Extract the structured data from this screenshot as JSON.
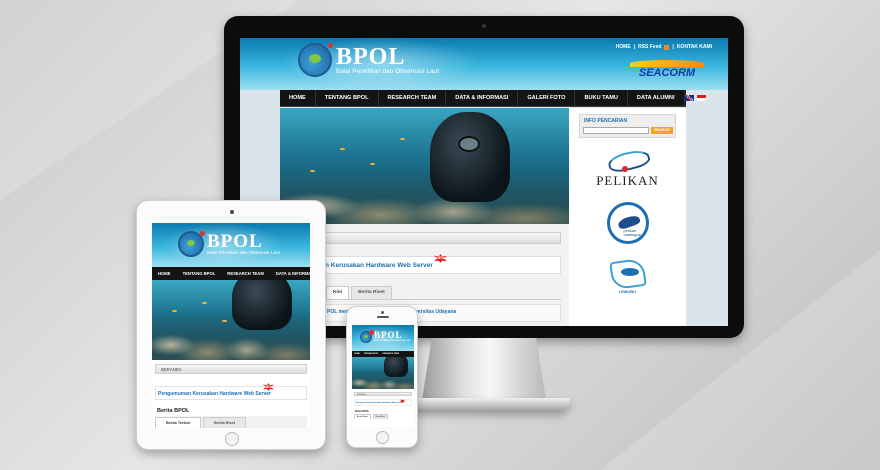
{
  "site": {
    "logo_title": "BPOL",
    "logo_subtitle": "Balai Penelitian dan Observasi Laut",
    "nav_items": [
      "HOME",
      "TENTANG BPOL",
      "RESEARCH TEAM",
      "DATA & INFORMASI",
      "GALERI FOTO",
      "BUKU TAMU",
      "DATA ALUMNI"
    ],
    "tablet_nav_items": [
      "HOME",
      "TENTANG BPOL",
      "RESEARCH TEAM",
      "DATA & INFORMASI"
    ],
    "phone_nav_items": [
      "HOME",
      "TENTANG BPOL",
      "RESEARCH TEAM"
    ],
    "colors": {
      "header_top": "#0a7bb0",
      "header_bottom": "#9fdff2",
      "nav_bg": "#141414",
      "link_blue": "#1f6fb0",
      "search_button": "#f0a51c",
      "new_badge": "#e0221c"
    }
  },
  "desktop": {
    "toplinks": {
      "home": "HOME",
      "sep1": "|",
      "rss": "RSS Feed",
      "sep2": "|",
      "contact": "KONTAK KAMI"
    },
    "partner_logo": {
      "title": "SEACORM"
    },
    "news_headline": "n Kerusakan Hardware Web Server",
    "new_badge": "NEW",
    "tabs": [
      {
        "label": "Kini"
      },
      {
        "label": "Berita Riset"
      }
    ],
    "article_headline": "POL mengisi Kuliah Tamu di FKP Universitas Udayana",
    "search": {
      "label": "INFO PENCARIAN",
      "placeholder": "",
      "button": "SEARCH"
    },
    "sidebar_partners": {
      "pelikan": "PELIKAN",
      "catalogue": "pelikan catalogue",
      "lemuru": "LEMURU"
    }
  },
  "tablet": {
    "breadcrumb": "BERANDA",
    "news_headline": "Pengumuman Kerusakan Hardware Web Server",
    "new_badge": "NEW",
    "section_title": "Berita BPOL",
    "tabs": [
      {
        "label": "Berita Terkini"
      },
      {
        "label": "Berita Riset"
      }
    ]
  },
  "phone": {
    "breadcrumb": "BERANDA",
    "news_headline": "Pengumuman Kerusakan Hardware Web Server",
    "new_badge": "NEW",
    "section_title": "Berita BPOL",
    "tabs": [
      {
        "label": "Berita Terkini"
      },
      {
        "label": "Berita Riset"
      }
    ]
  },
  "icons": {
    "flag_english": "uk-flag-icon",
    "flag_indonesia": "indonesia-flag-icon",
    "rss": "rss-icon",
    "logo": "bpol-logo-icon"
  }
}
